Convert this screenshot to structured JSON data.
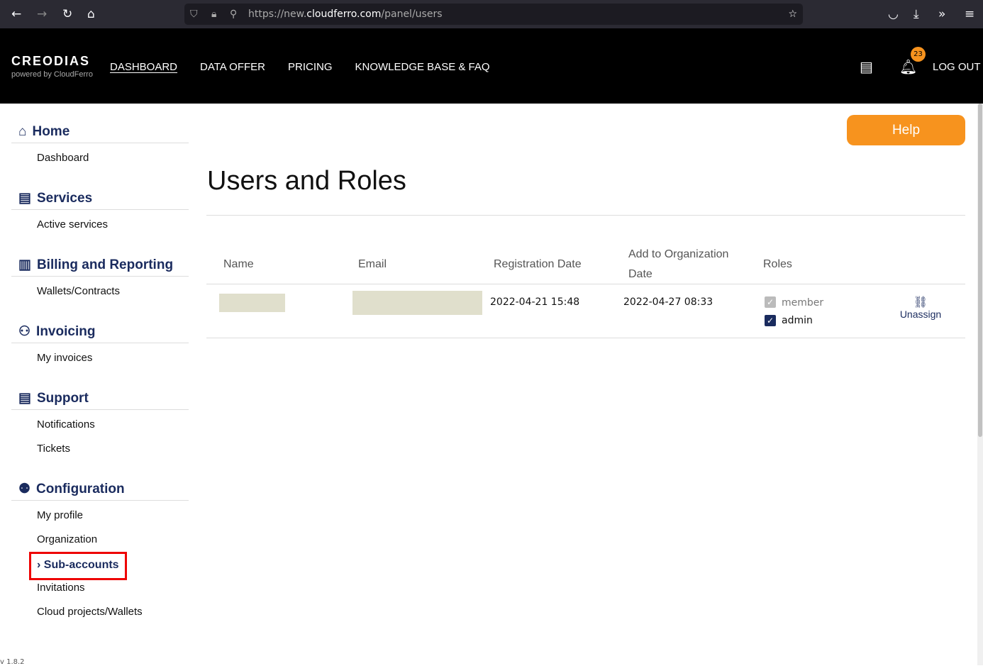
{
  "browser": {
    "url_prefix": "https://new.",
    "url_domain": "cloudferro.com",
    "url_path": "/panel/users"
  },
  "nav": {
    "logo": "CREODIAS",
    "powered_by": "powered by CloudFerro",
    "items": [
      "DASHBOARD",
      "DATA OFFER",
      "PRICING",
      "KNOWLEDGE BASE & FAQ"
    ],
    "notification_count": "23",
    "logout": "LOG OUT"
  },
  "sidebar": {
    "sections": [
      {
        "title": "Home",
        "icon": "home-icon",
        "items": [
          "Dashboard"
        ]
      },
      {
        "title": "Services",
        "icon": "list-icon",
        "items": [
          "Active services"
        ]
      },
      {
        "title": "Billing and Reporting",
        "icon": "billing-icon",
        "items": [
          "Wallets/Contracts"
        ]
      },
      {
        "title": "Invoicing",
        "icon": "invoice-icon",
        "items": [
          "My invoices"
        ]
      },
      {
        "title": "Support",
        "icon": "support-icon",
        "items": [
          "Notifications",
          "Tickets"
        ]
      },
      {
        "title": "Configuration",
        "icon": "user-config-icon",
        "items": [
          "My profile",
          "Organization",
          "Sub-accounts",
          "Invitations",
          "Cloud projects/Wallets"
        ]
      }
    ],
    "active": "Sub-accounts"
  },
  "main": {
    "help": "Help",
    "title": "Users and Roles",
    "columns": [
      "Name",
      "Email",
      "Registration Date",
      "Add to Organization Date",
      "Roles"
    ],
    "rows": [
      {
        "registration": "2022-04-21 15:48",
        "added": "2022-04-27 08:33",
        "roles": [
          {
            "label": "member",
            "checked": true,
            "disabled": true
          },
          {
            "label": "admin",
            "checked": true,
            "disabled": false
          }
        ],
        "action": "Unassign"
      }
    ]
  },
  "version": "v 1.8.2",
  "colors": {
    "accent": "#f7931e",
    "navy": "#1a2b5e"
  }
}
